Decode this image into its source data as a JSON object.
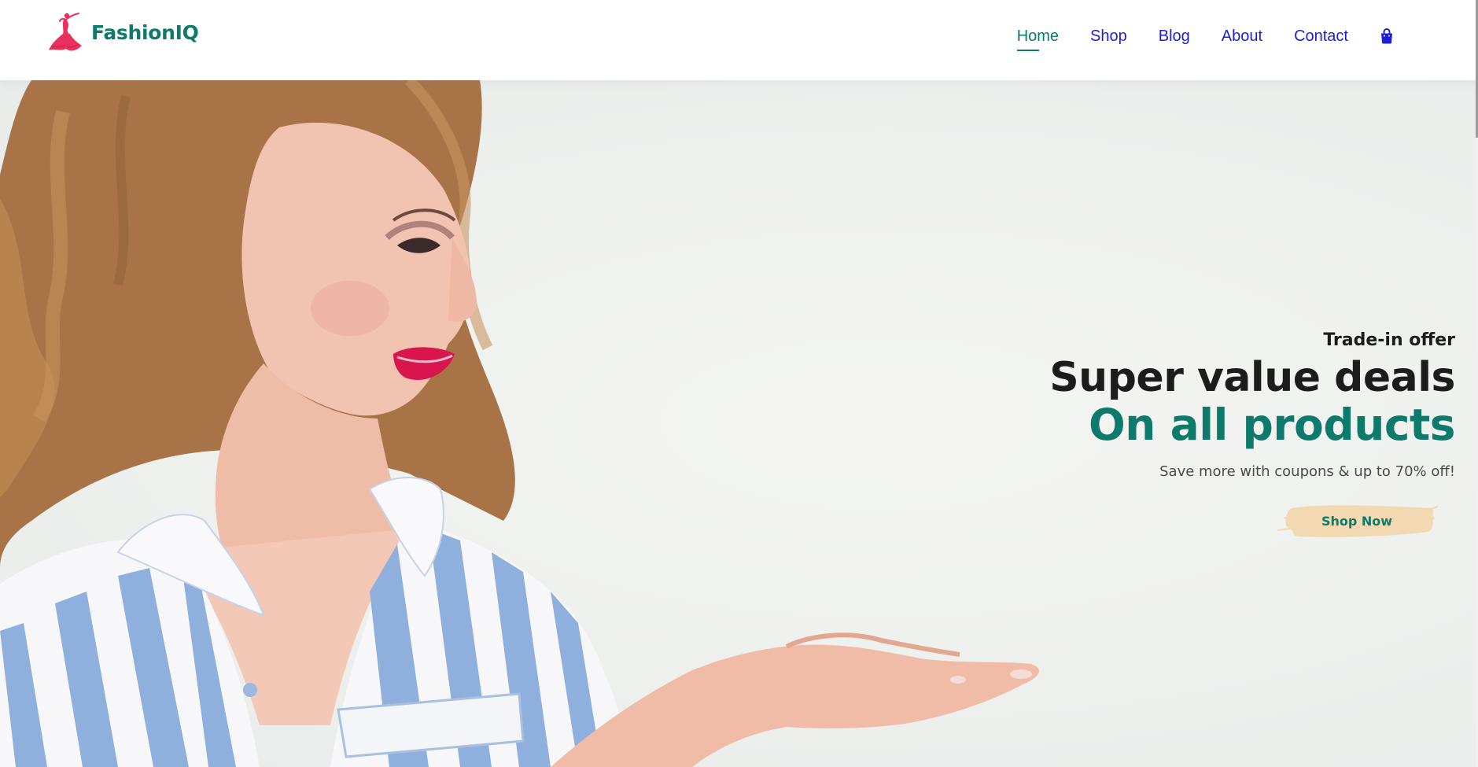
{
  "brand": {
    "name": "FashionIQ",
    "logo_icon": "dancing-woman-icon",
    "logo_color": "#e8315c",
    "name_color": "#0d7a6c"
  },
  "nav": {
    "items": [
      {
        "label": "Home",
        "active": true
      },
      {
        "label": "Shop",
        "active": false
      },
      {
        "label": "Blog",
        "active": false
      },
      {
        "label": "About",
        "active": false
      },
      {
        "label": "Contact",
        "active": false
      }
    ],
    "cart_icon": "shopping-bag-icon",
    "link_color": "#1d1ed6",
    "active_color": "#0d7a6c"
  },
  "hero": {
    "eyebrow": "Trade-in offer",
    "title": "Super value deals",
    "title_accent": "On all products",
    "subtitle": "Save more with coupons & up to 70% off!",
    "cta_label": "Shop Now",
    "cta_bg_color": "#f3d9b1",
    "accent_color": "#0d7a6c",
    "image_subject": "woman in blue-and-white striped shirt presenting open palm"
  }
}
